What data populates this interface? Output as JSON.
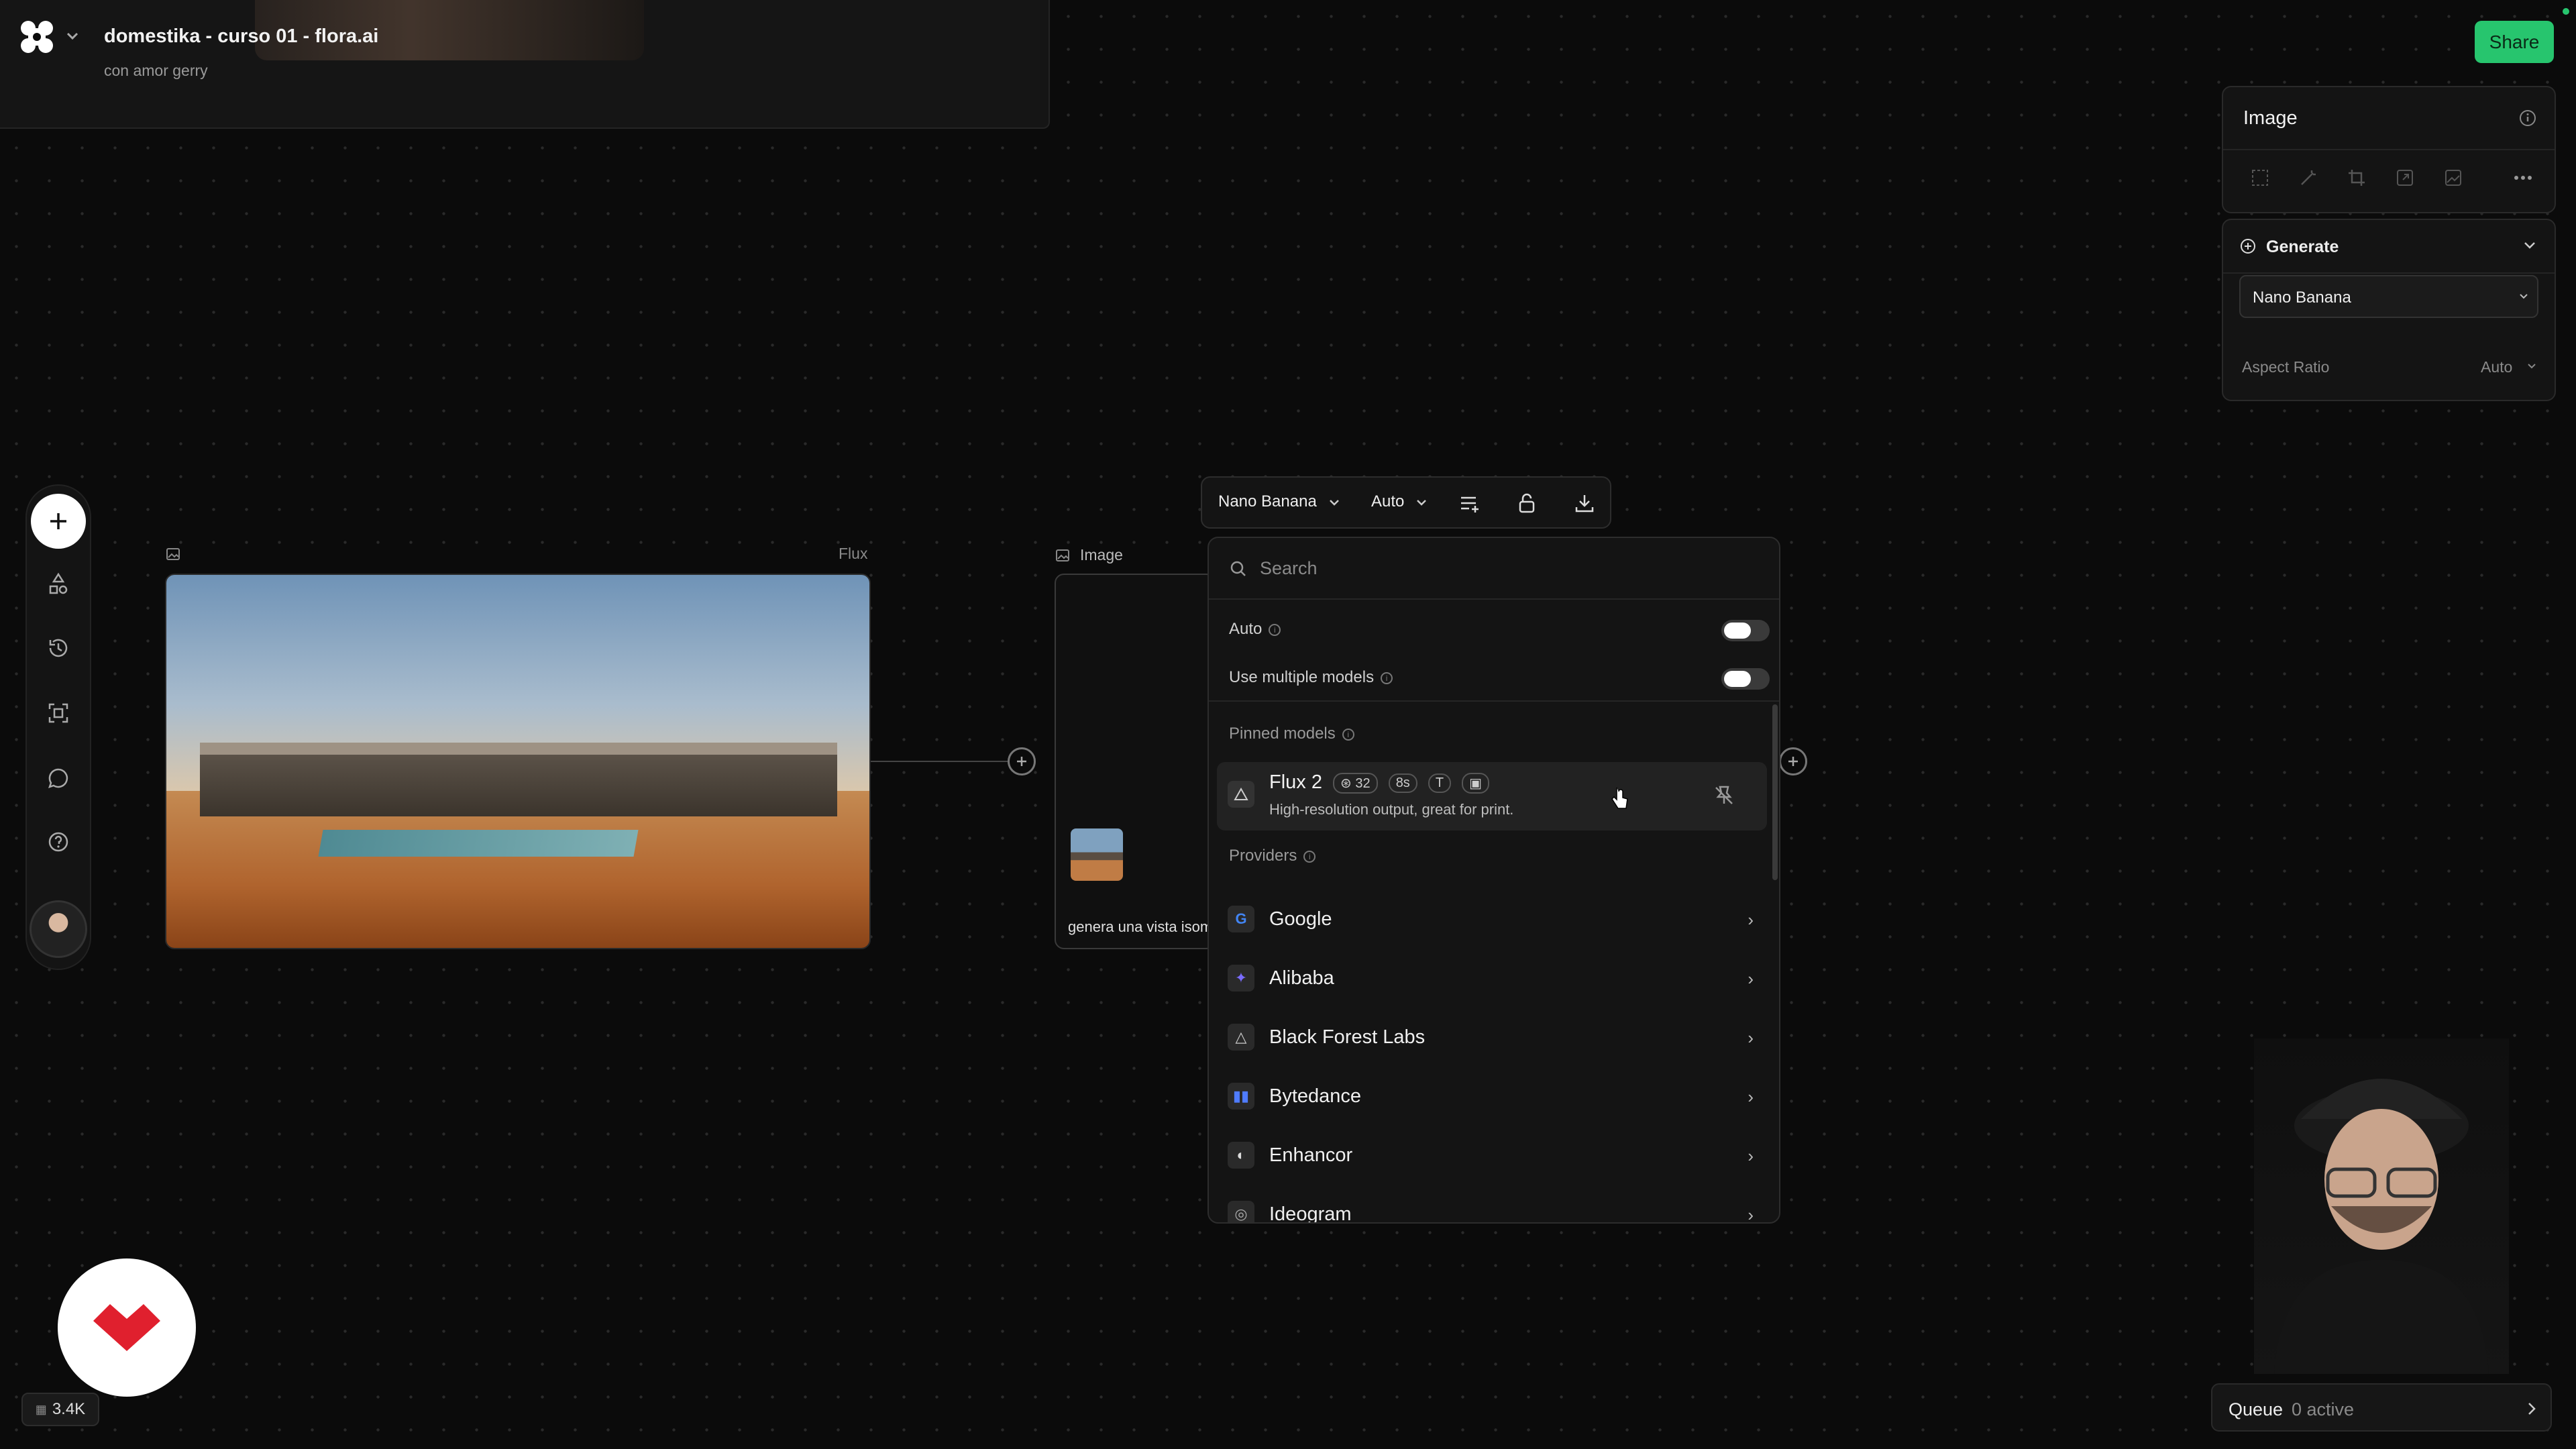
{
  "header": {
    "title": "domestika - curso 01 - flora.ai",
    "subtitle": "con amor gerry",
    "share_label": "Share"
  },
  "canvas": {
    "node1_model_label": "Flux",
    "node2_label": "Image",
    "node2_prompt": "genera una vista isom"
  },
  "model_toolbar": {
    "model": "Nano Banana",
    "aspect": "Auto"
  },
  "model_dropdown": {
    "search_placeholder": "Search",
    "auto_label": "Auto",
    "multi_label": "Use multiple models",
    "pinned_heading": "Pinned models",
    "pinned": {
      "name": "Flux 2",
      "credits": "32",
      "time": "8s",
      "tag_t": "T",
      "description": "High-resolution output, great for print."
    },
    "providers_heading": "Providers",
    "providers": [
      "Google",
      "Alibaba",
      "Black Forest Labs",
      "Bytedance",
      "Enhancor",
      "Ideogram"
    ]
  },
  "right_panel": {
    "title": "Image",
    "generate_label": "Generate",
    "model_select": "Nano Banana",
    "aspect_label": "Aspect Ratio",
    "aspect_value": "Auto"
  },
  "footer": {
    "count": "3.4K",
    "queue_label": "Queue",
    "queue_status": "0 active"
  },
  "colors": {
    "accent_green": "#27c56e",
    "domestika_red": "#e0202e"
  }
}
